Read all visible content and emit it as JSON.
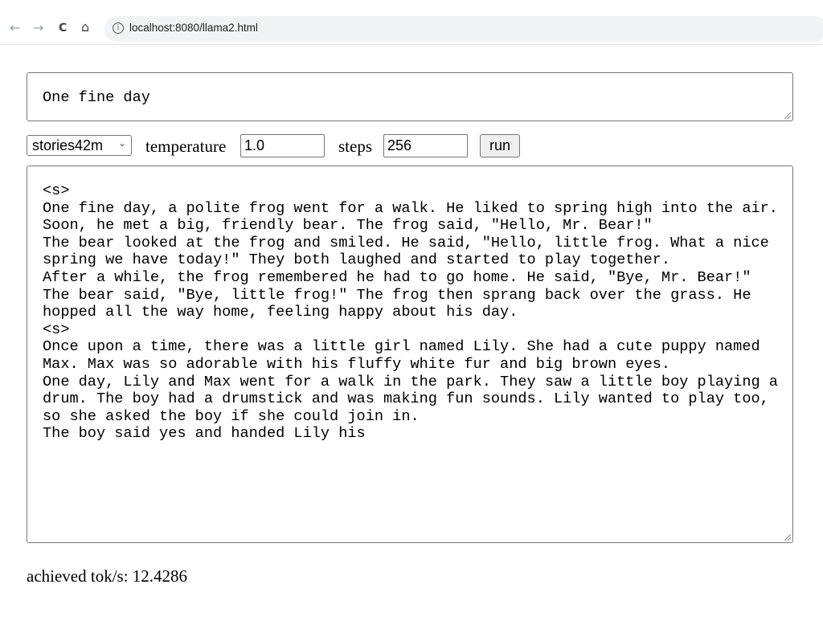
{
  "browser": {
    "url": "localhost:8080/llama2.html",
    "back_icon": "←",
    "forward_icon": "→",
    "reload_icon": "C",
    "home_icon": "⌂",
    "info_icon": "i"
  },
  "prompt": {
    "value": "One fine day"
  },
  "controls": {
    "model_select": "stories42m",
    "temperature_label": "temperature",
    "temperature_value": "1.0",
    "steps_label": "steps",
    "steps_value": "256",
    "run_label": "run"
  },
  "output": {
    "text": "<s>\nOne fine day, a polite frog went for a walk. He liked to spring high into the air. Soon, he met a big, friendly bear. The frog said, \"Hello, Mr. Bear!\"\nThe bear looked at the frog and smiled. He said, \"Hello, little frog. What a nice spring we have today!\" They both laughed and started to play together.\nAfter a while, the frog remembered he had to go home. He said, \"Bye, Mr. Bear!\"\nThe bear said, \"Bye, little frog!\" The frog then sprang back over the grass. He hopped all the way home, feeling happy about his day.\n<s>\nOnce upon a time, there was a little girl named Lily. She had a cute puppy named Max. Max was so adorable with his fluffy white fur and big brown eyes.\nOne day, Lily and Max went for a walk in the park. They saw a little boy playing a drum. The boy had a drumstick and was making fun sounds. Lily wanted to play too, so she asked the boy if she could join in.\nThe boy said yes and handed Lily his"
  },
  "status": {
    "text": "achieved tok/s: 12.4286"
  }
}
